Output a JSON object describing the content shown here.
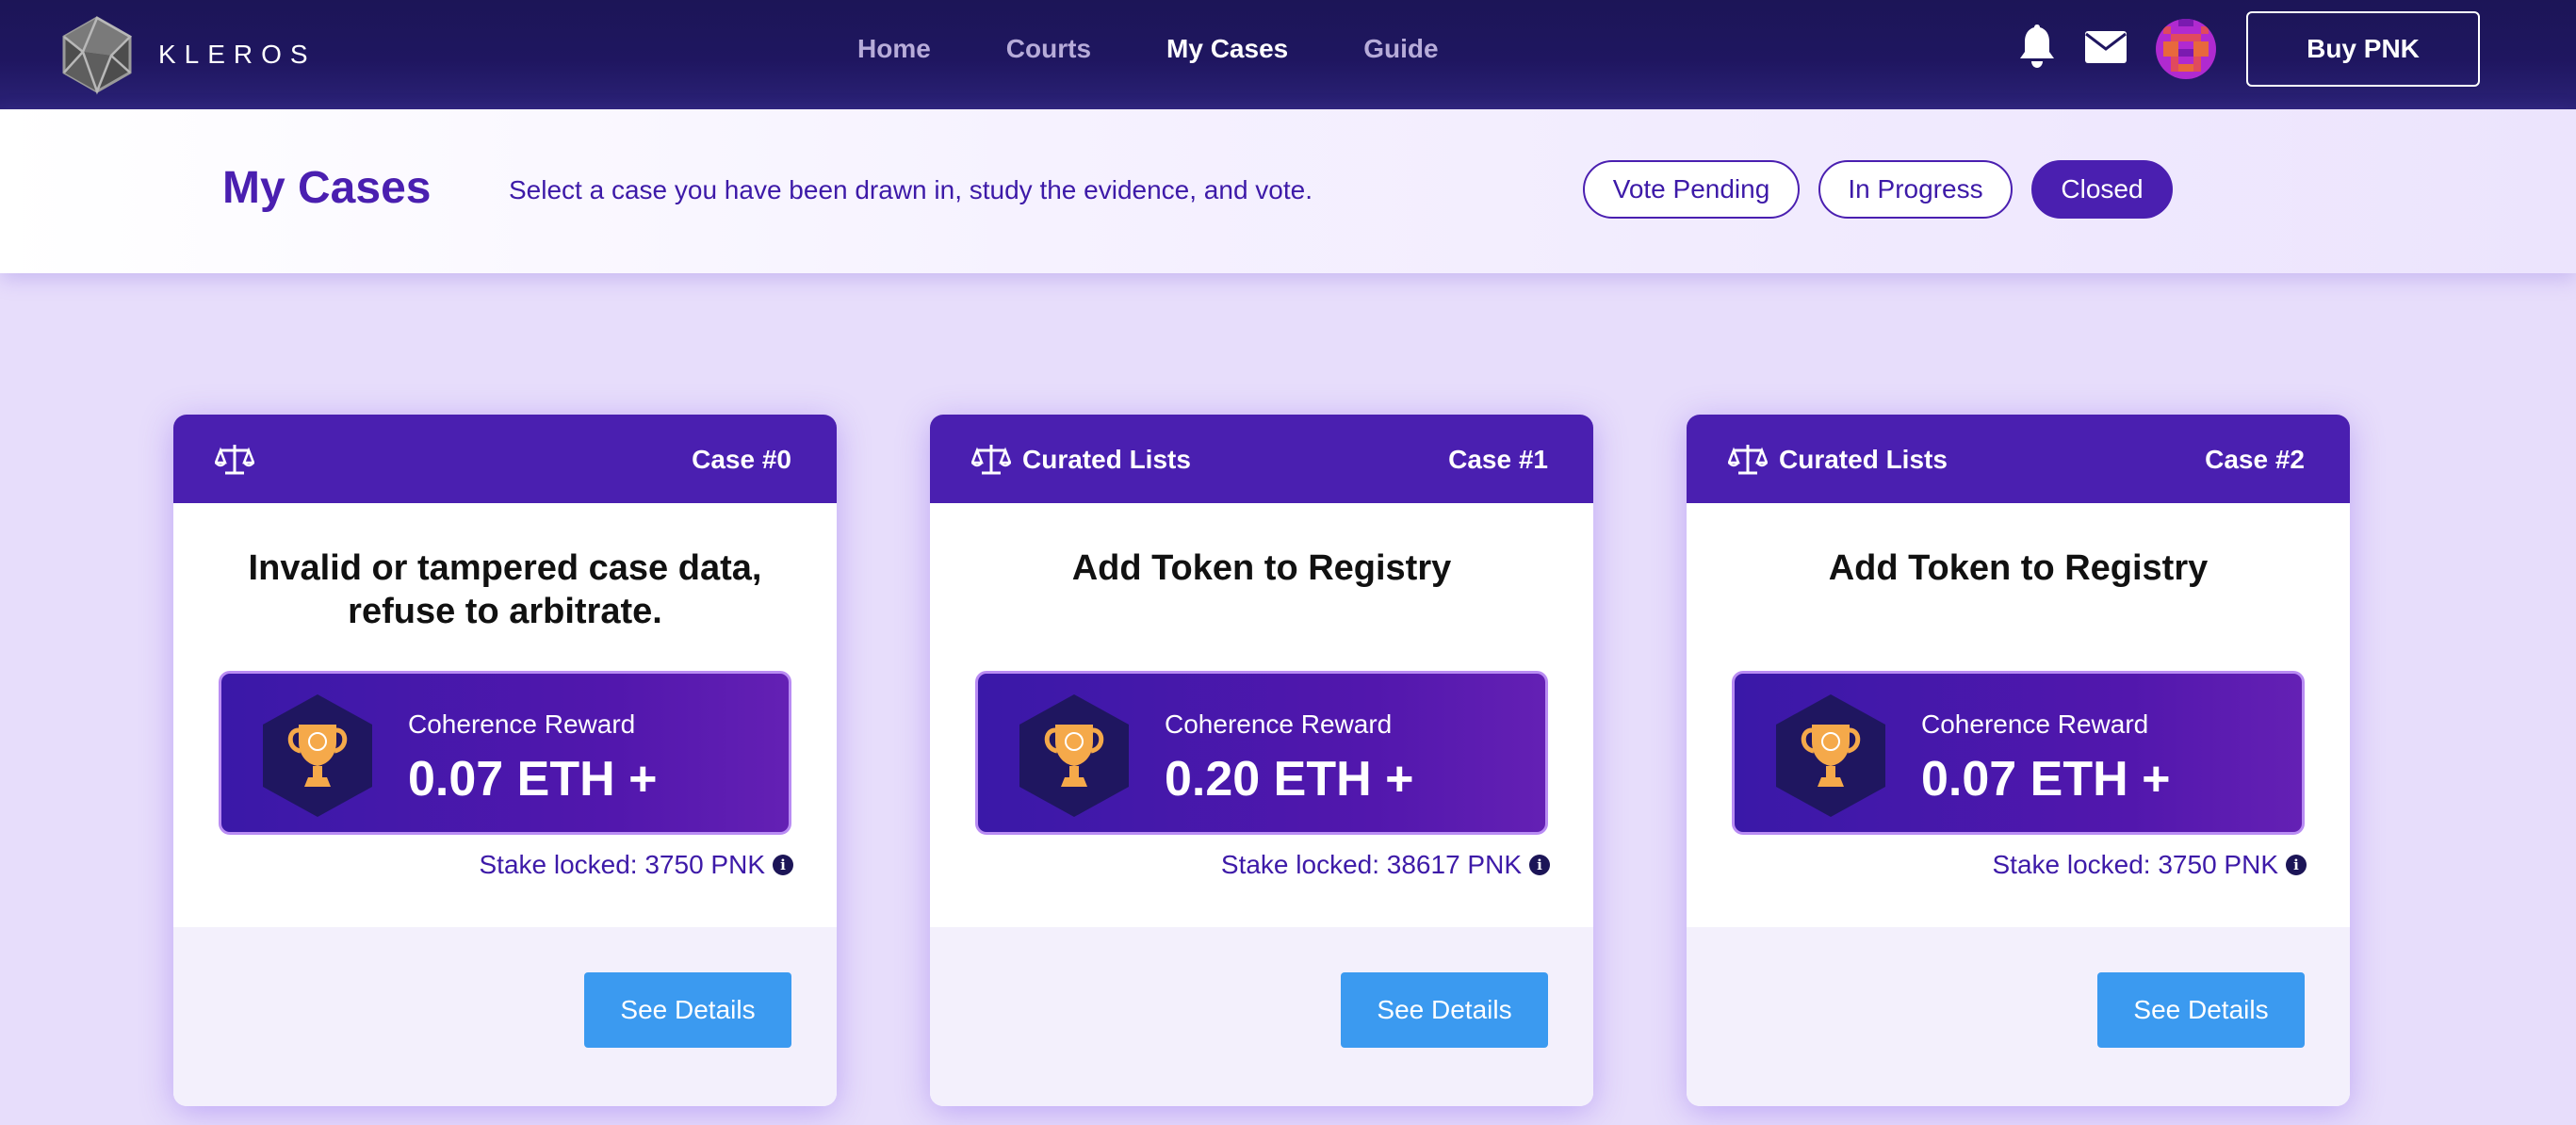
{
  "brand": {
    "name": "KLEROS"
  },
  "nav": {
    "items": [
      {
        "label": "Home",
        "active": false
      },
      {
        "label": "Courts",
        "active": false
      },
      {
        "label": "My Cases",
        "active": true
      },
      {
        "label": "Guide",
        "active": false
      }
    ]
  },
  "header_actions": {
    "bell_icon": "bell-icon",
    "mail_icon": "mail-icon",
    "buy_label": "Buy PNK"
  },
  "page": {
    "title": "My Cases",
    "description": "Select a case you have been drawn in, study the evidence, and vote.",
    "filters": [
      {
        "label": "Vote Pending",
        "selected": false
      },
      {
        "label": "In Progress",
        "selected": false
      },
      {
        "label": "Closed",
        "selected": true
      }
    ]
  },
  "cases": [
    {
      "court": "",
      "number": "Case #0",
      "title": "Invalid or tampered case data, refuse to arbitrate.",
      "reward_label": "Coherence Reward",
      "reward_value": "0.07 ETH +",
      "stake": "Stake locked: 3750 PNK",
      "button": "See Details"
    },
    {
      "court": "Curated Lists",
      "number": "Case #1",
      "title": "Add Token to Registry",
      "reward_label": "Coherence Reward",
      "reward_value": "0.20 ETH +",
      "stake": "Stake locked: 38617 PNK",
      "button": "See Details"
    },
    {
      "court": "Curated Lists",
      "number": "Case #2",
      "title": "Add Token to Registry",
      "reward_label": "Coherence Reward",
      "reward_value": "0.07 ETH +",
      "stake": "Stake locked: 3750 PNK",
      "button": "See Details"
    }
  ],
  "colors": {
    "nav_bg": "#1f1660",
    "accent_purple": "#4a1fb0",
    "button_blue": "#3b9af0",
    "page_bg": "#e7ddfb"
  }
}
